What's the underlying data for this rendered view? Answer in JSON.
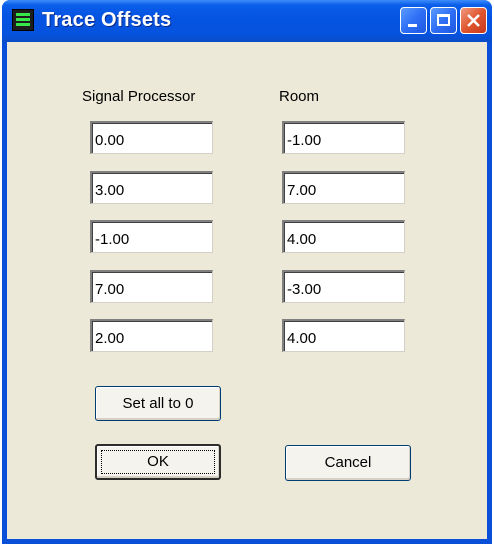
{
  "window": {
    "title": "Trace Offsets",
    "title_color": "#ffffff",
    "titlebar_color": "#0653df",
    "face_color": "#ece9d8"
  },
  "columns": {
    "signal_processor_label": "Signal Processor",
    "room_label": "Room"
  },
  "signal_processor": [
    "0.00",
    "3.00",
    "-1.00",
    "7.00",
    "2.00"
  ],
  "room": [
    "-1.00",
    "7.00",
    "4.00",
    "-3.00",
    "4.00"
  ],
  "buttons": {
    "set_all": "Set all to 0",
    "ok": "OK",
    "cancel": "Cancel"
  },
  "icons": {
    "app": "trace-app-icon",
    "minimize": "minimize-icon",
    "maximize": "maximize-icon",
    "close": "close-icon"
  }
}
